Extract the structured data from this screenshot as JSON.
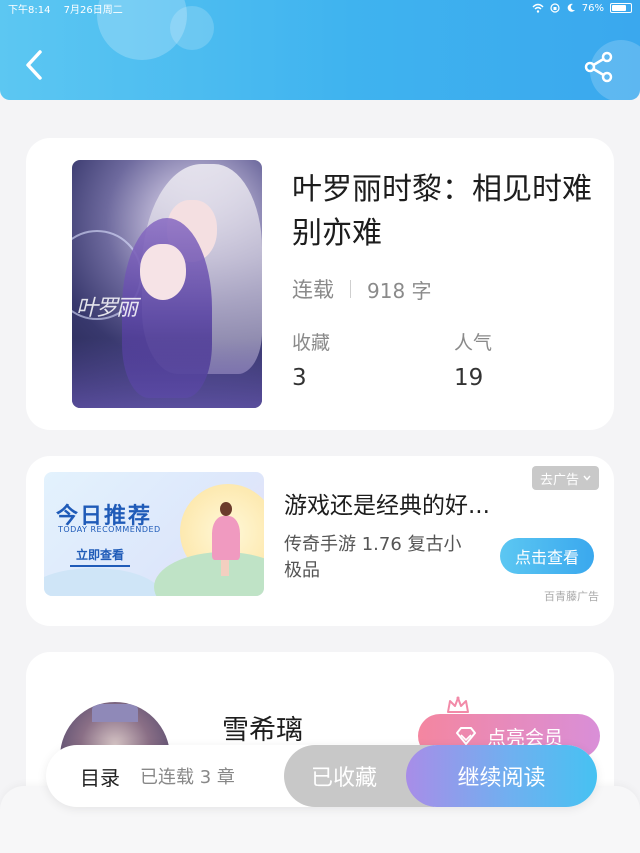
{
  "status_bar": {
    "time": "下午8:14",
    "date": "7月26日周二",
    "battery": "76%",
    "battery_level": 0.76
  },
  "header": {
    "back_icon": "chevron-left-icon",
    "share_icon": "share-icon",
    "accent_color": "#3aa8ee"
  },
  "book": {
    "title": "叶罗丽时黎：相见时难别亦难",
    "status": "连载",
    "word_count": "918 字",
    "favorites_label": "收藏",
    "favorites_value": "3",
    "popularity_label": "人气",
    "popularity_value": "19",
    "cover_text": "叶罗丽"
  },
  "ad": {
    "banner_title": "今日推荐",
    "banner_subtitle": "TODAY RECOMMENDED",
    "banner_button": "立即查看",
    "title": "游戏还是经典的好...",
    "description": "传奇手游 1.76 复古小极品",
    "remove_label": "去广告",
    "cta_label": "点击查看",
    "source": "百青藤广告"
  },
  "author": {
    "name": "雪希璃",
    "vip_label": "点亮会员"
  },
  "bottom_bar": {
    "toc_label": "目录",
    "toc_progress": "已连载 3 章",
    "collect_label": "已收藏",
    "read_label": "继续阅读"
  }
}
